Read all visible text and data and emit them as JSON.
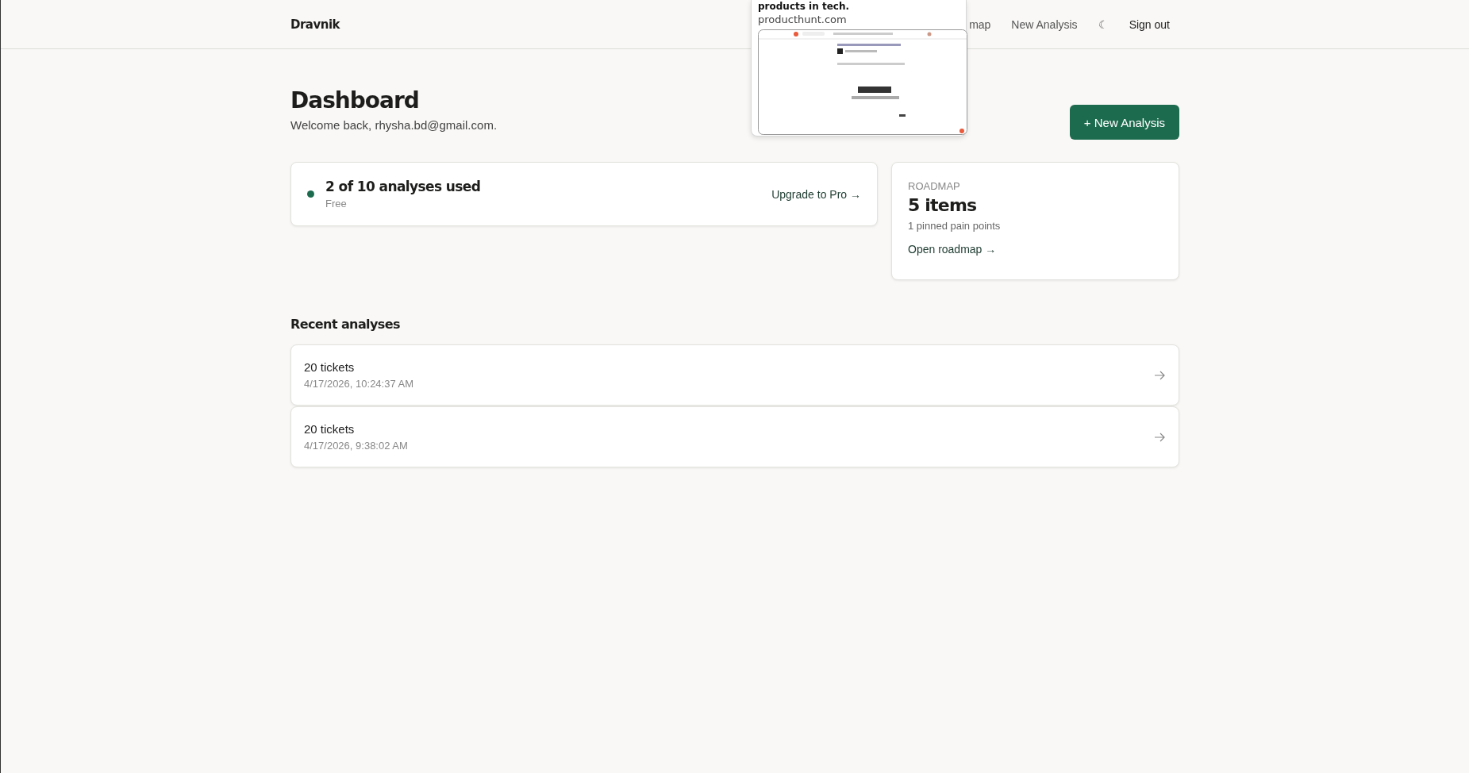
{
  "header": {
    "logo": "Dravnik",
    "nav": [
      "map",
      "New Analysis"
    ],
    "theme_icon": "☾",
    "sign_out": "Sign out"
  },
  "tab_preview": {
    "title": "products in tech.",
    "url": "producthunt.com"
  },
  "page": {
    "title": "Dashboard",
    "subtitle": "Welcome back, rhysha.bd@gmail.com.",
    "primary_button": "+ New Analysis"
  },
  "usage_card": {
    "title": "2 of 10 analyses used",
    "plan": "Free",
    "link": "Upgrade to Pro →"
  },
  "roadmap_card": {
    "label": "ROADMAP",
    "count": "5 items",
    "detail": "1 pinned pain points",
    "link": "Open roadmap →"
  },
  "recent": {
    "title": "Recent analyses",
    "rows": [
      {
        "name": "20 tickets",
        "date": "4/17/2026, 10:24:37 AM"
      },
      {
        "name": "20 tickets",
        "date": "4/17/2026, 9:38:02 AM"
      }
    ]
  }
}
